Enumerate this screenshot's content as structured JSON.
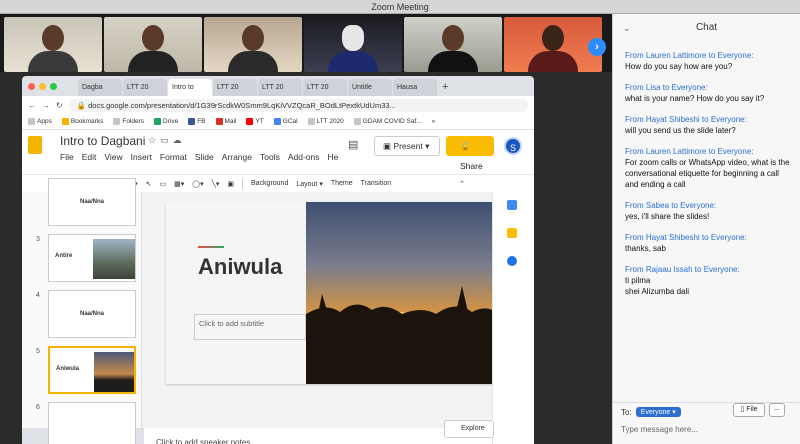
{
  "window": {
    "title": "Zoom Meeting"
  },
  "video": {
    "tiles": 6,
    "next_icon": "chevron-right-icon"
  },
  "chat": {
    "title": "Chat",
    "messages": [
      {
        "from": "From Lauren Lattimore to Everyone:",
        "text": "How do you say how are you?"
      },
      {
        "from": "From Lisa to Everyone:",
        "text": "what is your name? How do you say it?"
      },
      {
        "from": "From Hayat Shibeshi to Everyone:",
        "text": "will you send us the slide later?"
      },
      {
        "from": "From Lauren Lattimore to Everyone:",
        "text": "For zoom calls or WhatsApp video, what is the conversational etiquette for beginning a call and ending a call"
      },
      {
        "from": "From Sabea to Everyone:",
        "text": "yes, i'll share the slides!"
      },
      {
        "from": "From Hayat Shibeshi to Everyone:",
        "text": "thanks, sab"
      },
      {
        "from": "From Rajaau Issah to Everyone:",
        "text": "ti pilma\nshei Alizumba dali"
      }
    ],
    "to_label": "To:",
    "to_value": "Everyone",
    "file_label": "File",
    "more_label": "...",
    "input_placeholder": "Type message here..."
  },
  "browser": {
    "tabs": [
      "Dagba",
      "LTT 20",
      "Intro to",
      "LTT 20",
      "LTT 20",
      "LTT 20",
      "Untitle",
      "Hausa"
    ],
    "active_tab": 2,
    "url": "docs.google.com/presentation/d/1G39rScdkW0Smm9LqKiVVZQcaR_BOdLtPextkUdUm33...",
    "bookmarks": [
      "Apps",
      "Bookmarks",
      "Folders",
      "Drive",
      "FB",
      "Mail",
      "YT",
      "GCal",
      "LTT 2020",
      "GDAM COVID Saf..."
    ],
    "bookmarks_more": "»"
  },
  "slides": {
    "doc_title": "Intro to Dagbani",
    "menu": [
      "File",
      "Edit",
      "View",
      "Insert",
      "Format",
      "Slide",
      "Arrange",
      "Tools",
      "Add-ons",
      "He"
    ],
    "present_label": "Present",
    "share_label": "Share",
    "avatar_letter": "S",
    "toolbar": {
      "background": "Background",
      "layout": "Layout",
      "theme": "Theme",
      "transition": "Transition"
    },
    "thumbnails": [
      {
        "num": "",
        "label": "Naa/Nna"
      },
      {
        "num": "3",
        "label": "Antire"
      },
      {
        "num": "4",
        "label": "Naa/Nna"
      },
      {
        "num": "5",
        "label": "Aniwula"
      },
      {
        "num": "6",
        "label": ""
      }
    ],
    "current_slide": {
      "title": "Aniwula",
      "subtitle_placeholder": "Click to add subtitle"
    },
    "speaker_notes": "Click to add speaker notes",
    "explore_label": "Explore"
  }
}
